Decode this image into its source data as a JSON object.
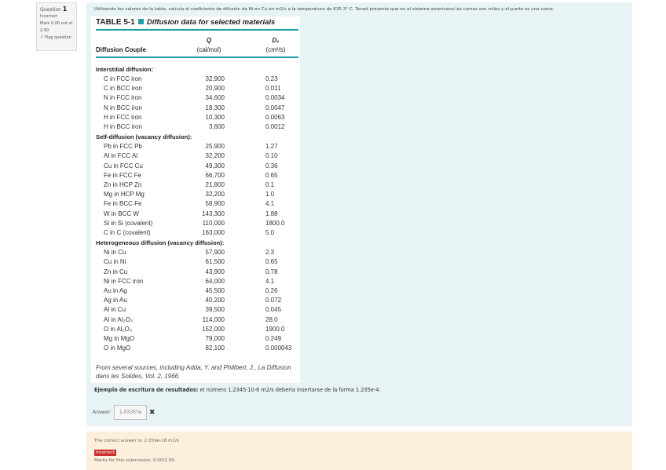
{
  "info": {
    "question_label": "Question",
    "question_number": "1",
    "status": "Incorrect",
    "mark": "Mark 0.00 out of",
    "mark2": "2.00",
    "flag": "Flag question"
  },
  "question": {
    "text": "Utilizando los valores de la tabla, calcula el coeficiente de difusión de Ni en Cu en m2/s a la temperatura de 635.3° C. Tened presente que en el sistema americano las comas son miles y el punto es una coma."
  },
  "table": {
    "title_num": "TABLE 5-1",
    "title": "Diffusion data for selected materials",
    "col_couple": "Diffusion Couple",
    "col_q": "Q",
    "col_q_unit": "(cal/mol)",
    "col_d": "D₀",
    "col_d_unit": "(cm²/s)",
    "sections": [
      {
        "name": "Interstitial diffusion:",
        "rows": [
          [
            "C in FCC iron",
            "32,900",
            "0.23"
          ],
          [
            "C in BCC iron",
            "20,900",
            "0.011"
          ],
          [
            "N in FCC iron",
            "34,600",
            "0.0034"
          ],
          [
            "N in BCC iron",
            "18,300",
            "0.0047"
          ],
          [
            "H in FCC iron",
            "10,300",
            "0.0063"
          ],
          [
            "H in BCC iron",
            "3,600",
            "0.0012"
          ]
        ]
      },
      {
        "name": "Self-diffusion (vacancy diffusion):",
        "rows": [
          [
            "Pb in FCC Pb",
            "25,900",
            "1.27"
          ],
          [
            "Al in FCC Al",
            "32,200",
            "0.10"
          ],
          [
            "Cu in FCC Cu",
            "49,300",
            "0.36"
          ],
          [
            "Fe in FCC Fe",
            "66,700",
            "0.65"
          ],
          [
            "Zn in HCP Zn",
            "21,800",
            "0.1"
          ],
          [
            "Mg in HCP Mg",
            "32,200",
            "1.0"
          ],
          [
            "Fe in BCC Fe",
            "58,900",
            "4.1"
          ],
          [
            "W in BCC W",
            "143,300",
            "1.88"
          ],
          [
            "Si in Si (covalent)",
            "110,000",
            "1800.0"
          ],
          [
            "C in C (covalent)",
            "163,000",
            "5.0"
          ]
        ]
      },
      {
        "name": "Heterogeneous diffusion (vacancy diffusion):",
        "rows": [
          [
            "Ni in Cu",
            "57,900",
            "2.3"
          ],
          [
            "Cu in Ni",
            "61,500",
            "0.65"
          ],
          [
            "Zn in Cu",
            "43,900",
            "0.78"
          ],
          [
            "Ni in FCC iron",
            "64,000",
            "4.1"
          ],
          [
            "Au in Ag",
            "45,500",
            "0.26"
          ],
          [
            "Ag in Au",
            "40,200",
            "0.072"
          ],
          [
            "Al in Cu",
            "39,500",
            "0.045"
          ],
          [
            "Al in Al₂O₃",
            "114,000",
            "28.0"
          ],
          [
            "O in Al₂O₃",
            "152,000",
            "1900.0"
          ],
          [
            "Mg in MgO",
            "79,000",
            "0.249"
          ],
          [
            "O in MgO",
            "82,100",
            "0.000043"
          ]
        ]
      }
    ],
    "source": "From several sources, including Adda, Y. and Philibert, J., La Diffusion dans les Solides, Vol. 2, 1966."
  },
  "example": {
    "bold": "Ejemplo de escritura de resultados:",
    "text": " el número 1,2345·10-6 m2/s debería insertarse de la forma 1.235e-4."
  },
  "answer": {
    "label": "Answer:",
    "value": "1.0335?e"
  },
  "feedback": {
    "correct": "The correct answer is: 2.059e-18 m2/s",
    "badge": "Incorrect",
    "marks": "Marks for this submission: 0.00/2.00."
  }
}
